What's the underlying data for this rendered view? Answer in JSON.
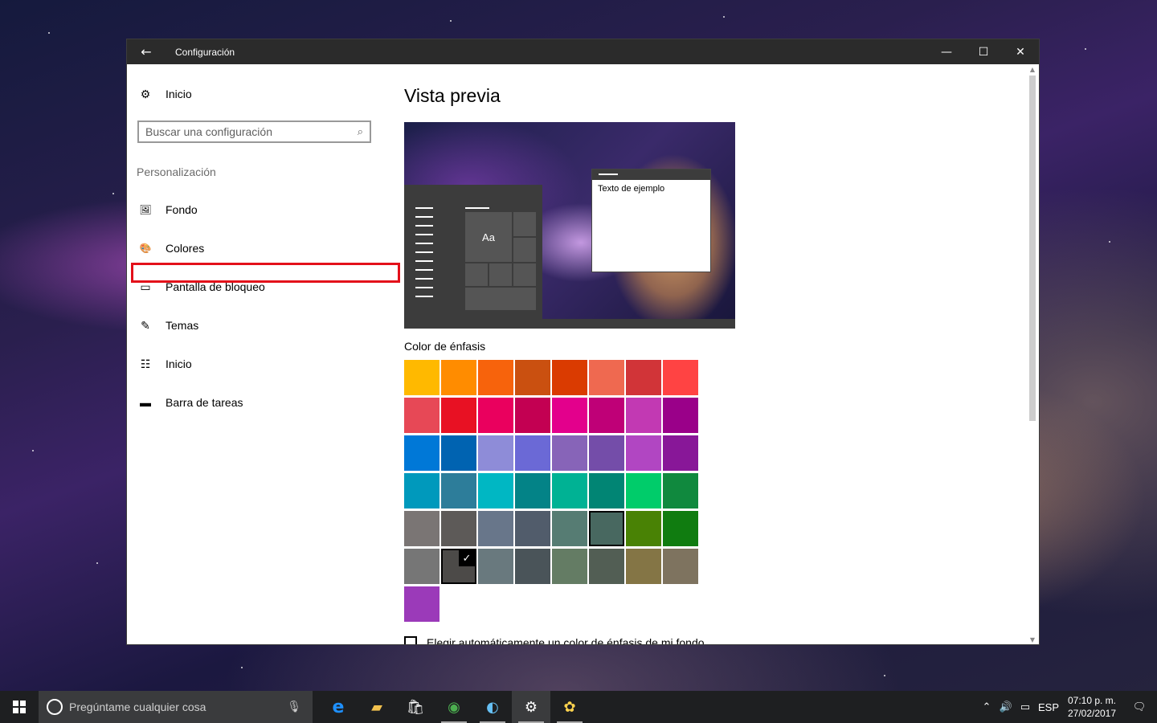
{
  "window": {
    "title": "Configuración",
    "back_icon": "←",
    "controls": {
      "minimize": "—",
      "maximize": "☐",
      "close": "✕"
    }
  },
  "sidebar": {
    "home_label": "Inicio",
    "search_placeholder": "Buscar una configuración",
    "section_label": "Personalización",
    "items": [
      {
        "label": "Fondo",
        "icon": "picture-icon",
        "glyph": "🖼"
      },
      {
        "label": "Colores",
        "icon": "palette-icon",
        "glyph": "🎨"
      },
      {
        "label": "Pantalla de bloqueo",
        "icon": "lock-screen-icon",
        "glyph": "▭"
      },
      {
        "label": "Temas",
        "icon": "brush-icon",
        "glyph": "✎"
      },
      {
        "label": "Inicio",
        "icon": "start-icon",
        "glyph": "☷"
      },
      {
        "label": "Barra de tareas",
        "icon": "taskbar-icon",
        "glyph": "▬"
      }
    ]
  },
  "main": {
    "heading": "Vista previa",
    "preview": {
      "tile_text": "Aa",
      "sample_text": "Texto de ejemplo"
    },
    "accent_label": "Color de énfasis",
    "auto_label": "Elegir automáticamente un color de énfasis de mi fondo",
    "swatches": [
      [
        "#FFB900",
        "#FF8C00",
        "#F7630C",
        "#CA5010",
        "#DA3B01",
        "#EF6950",
        "#D13438",
        "#FF4343"
      ],
      [
        "#E74856",
        "#E81123",
        "#EA005E",
        "#C30052",
        "#E3008C",
        "#BF0077",
        "#C239B3",
        "#9A0089"
      ],
      [
        "#0078D7",
        "#0063B1",
        "#8E8CD8",
        "#6B69D6",
        "#8764B8",
        "#744DA9",
        "#B146C2",
        "#881798"
      ],
      [
        "#0099BC",
        "#2D7D9A",
        "#00B7C3",
        "#038387",
        "#00B294",
        "#018574",
        "#00CC6A",
        "#10893E"
      ],
      [
        "#7A7574",
        "#5D5A58",
        "#68768A",
        "#515C6B",
        "#567C73",
        "#486860",
        "#498205",
        "#107C10"
      ],
      [
        "#767676",
        "#4C4A48",
        "#69797E",
        "#4A5459",
        "#647C64",
        "#525E54",
        "#847545",
        "#7E735F"
      ],
      [
        "#9B3AB9"
      ]
    ],
    "selected_frame": [
      4,
      5
    ],
    "selected_check": [
      5,
      1
    ]
  },
  "taskbar": {
    "search_placeholder": "Pregúntame cualquier cosa",
    "apps": [
      {
        "name": "edge-icon",
        "glyph": "e",
        "color": "#1e90ff"
      },
      {
        "name": "file-explorer-icon",
        "glyph": "▰",
        "color": "#f2c14e"
      },
      {
        "name": "store-icon",
        "glyph": "🛍",
        "color": "#ffffff"
      },
      {
        "name": "chrome-icon",
        "glyph": "◉",
        "color": "#4caf50"
      },
      {
        "name": "steam-icon",
        "glyph": "◐",
        "color": "#66c0f4"
      },
      {
        "name": "settings-icon",
        "glyph": "⚙",
        "color": "#ffffff"
      },
      {
        "name": "paint-icon",
        "glyph": "✿",
        "color": "#ffd34e"
      }
    ],
    "tray": {
      "language": "ESP",
      "time": "07:10 p. m.",
      "date": "27/02/2017"
    }
  }
}
